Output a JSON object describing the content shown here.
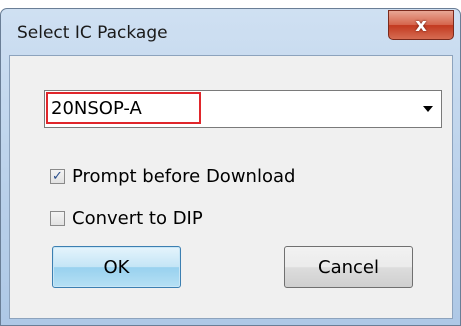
{
  "window": {
    "title": "Select IC Package",
    "close_glyph": "x"
  },
  "package_select": {
    "value": "20NSOP-A",
    "icon": "chevron-down-icon"
  },
  "options": {
    "prompt_before_download": {
      "label": "Prompt before Download",
      "checked": true,
      "mark": "✓"
    },
    "convert_to_dip": {
      "label": "Convert to DIP",
      "checked": false,
      "mark": ""
    }
  },
  "buttons": {
    "ok": "OK",
    "cancel": "Cancel"
  },
  "colors": {
    "highlight": "#e0262b",
    "close_button": "#c2391f",
    "ok_button": "#98d1ef"
  }
}
